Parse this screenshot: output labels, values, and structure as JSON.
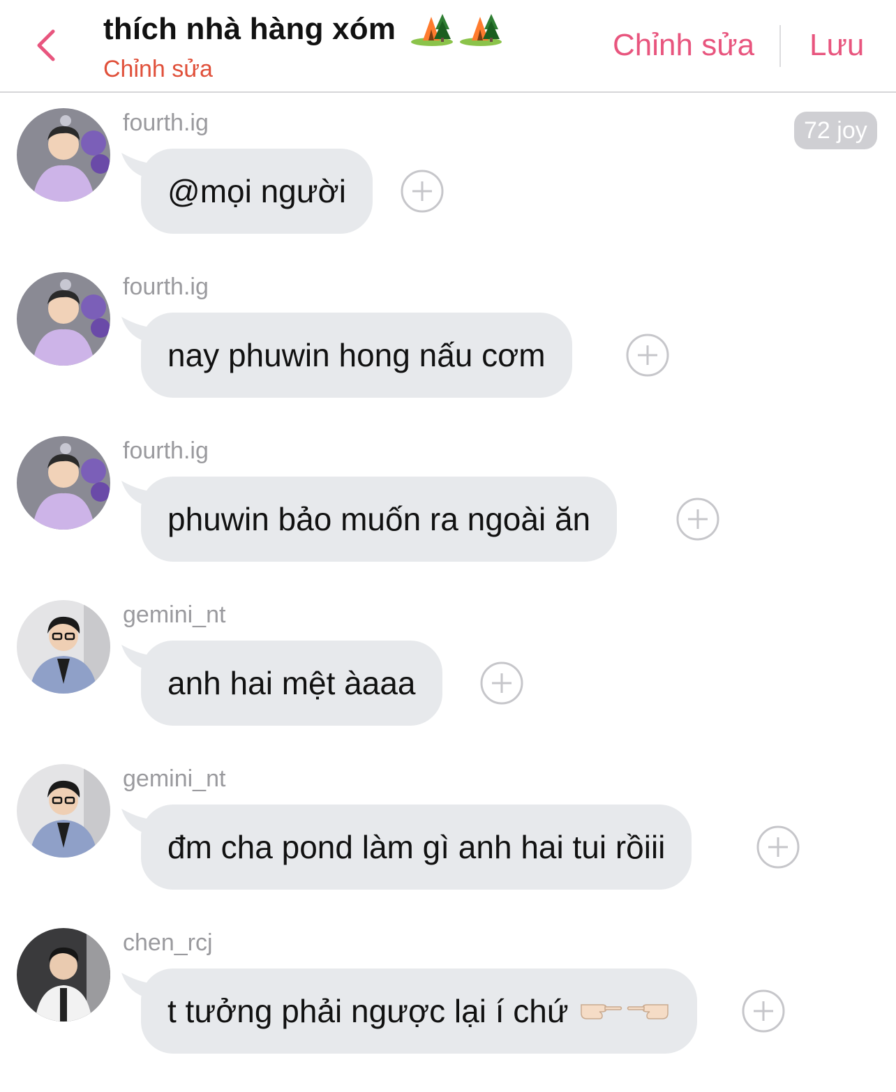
{
  "header": {
    "title": "thích nhà hàng xóm",
    "title_emoji": "camping-icon camping-icon",
    "subtitle": "Chỉnh sửa",
    "edit_label": "Chỉnh sửa",
    "save_label": "Lưu"
  },
  "timestamp": "72 joy",
  "colors": {
    "accent": "#e8557e",
    "subtitle": "#e0503a",
    "bubble": "#e7e9ec",
    "username": "#9a9a9e"
  },
  "messages": [
    {
      "user": "fourth.ig",
      "text": "@mọi người"
    },
    {
      "user": "fourth.ig",
      "text": "nay phuwin hong nấu cơm"
    },
    {
      "user": "fourth.ig",
      "text": "phuwin bảo muốn ra ngoài ăn"
    },
    {
      "user": "gemini_nt",
      "text": "anh hai mệt àaaa"
    },
    {
      "user": "gemini_nt",
      "text": "đm cha pond làm gì anh hai tui rồiii"
    },
    {
      "user": "chen_rcj",
      "text": "t tưởng phải ngược lại í chứ",
      "emoji": "pointing-hands-icon"
    }
  ]
}
